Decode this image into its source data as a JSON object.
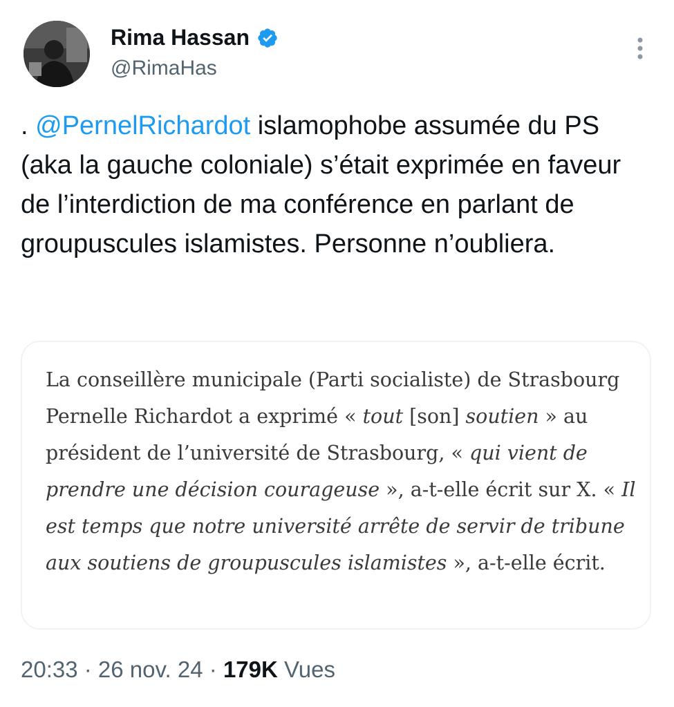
{
  "author": {
    "display_name": "Rima Hassan",
    "handle": "@RimaHas",
    "verified": true
  },
  "tweet": {
    "prefix": ". ",
    "mention": "@PernelRichardot",
    "text": " islamophobe assumée du PS (aka la gauche coloniale) s’était exprimée en faveur de l’interdiction de ma conférence en parlant de groupuscules islamistes. Personne n’oubliera."
  },
  "quote": {
    "segments": [
      {
        "t": "La conseillère municipale (Parti socialiste) de Strasbourg Pernelle Richardot a exprimé « ",
        "i": false
      },
      {
        "t": "tout",
        "i": true
      },
      {
        "t": " [son] ",
        "i": false
      },
      {
        "t": "soutien",
        "i": true
      },
      {
        "t": " » au président de l’université de Strasbourg, « ",
        "i": false
      },
      {
        "t": "qui vient de prendre une décision courageuse",
        "i": true
      },
      {
        "t": " », a-t-elle écrit sur X. « ",
        "i": false
      },
      {
        "t": "Il est temps que notre université arrête de servir de tribune aux soutiens de groupuscules islamistes",
        "i": true
      },
      {
        "t": " », a-t-elle écrit.",
        "i": false
      }
    ]
  },
  "meta": {
    "time": "20:33",
    "sep1": " · ",
    "date": "26 nov. 24",
    "sep2": " · ",
    "views_count": "179K",
    "views_label": " Vues"
  },
  "colors": {
    "accent": "#1d9bf0",
    "text": "#0f1419",
    "muted": "#536471"
  }
}
